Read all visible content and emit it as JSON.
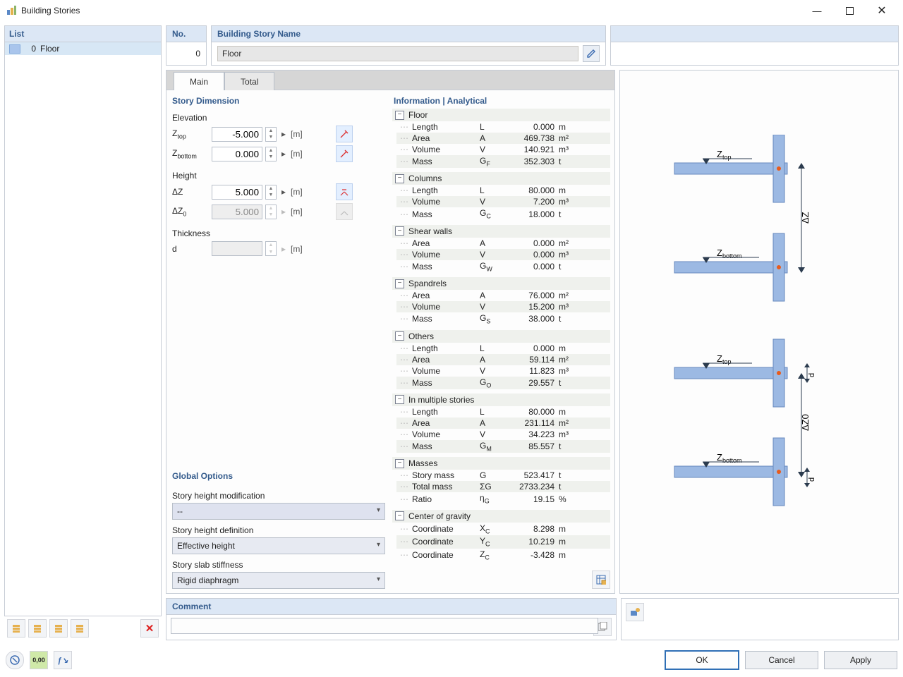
{
  "window": {
    "title": "Building Stories"
  },
  "left": {
    "header": "List",
    "items": [
      {
        "index": "0",
        "name": "Floor"
      }
    ]
  },
  "top": {
    "no_label": "No.",
    "no_value": "0",
    "name_label": "Building Story Name",
    "name_value": "Floor"
  },
  "tabs": {
    "main": "Main",
    "total": "Total"
  },
  "story_dim": {
    "header": "Story Dimension",
    "elev_label": "Elevation",
    "z_top": "Z",
    "z_top_sub": "top",
    "z_top_val": "-5.000",
    "unit": "[m]",
    "z_bot": "Z",
    "z_bot_sub": "bottom",
    "z_bot_val": "0.000",
    "height_label": "Height",
    "dz": "ΔZ",
    "dz_val": "5.000",
    "dz0": "ΔZ",
    "dz0_sub": "0",
    "dz0_val": "5.000",
    "thick_label": "Thickness",
    "d": "d",
    "d_val": ""
  },
  "globals": {
    "header": "Global Options",
    "mod_label": "Story height modification",
    "mod_val": "--",
    "def_label": "Story height definition",
    "def_val": "Effective height",
    "slab_label": "Story slab stiffness",
    "slab_val": "Rigid diaphragm"
  },
  "info": {
    "header": "Information | Analytical",
    "sections": [
      {
        "title": "Floor",
        "rows": [
          {
            "n": "Length",
            "s": "L",
            "v": "0.000",
            "u": "m"
          },
          {
            "n": "Area",
            "s": "A",
            "v": "469.738",
            "u": "m²"
          },
          {
            "n": "Volume",
            "s": "V",
            "v": "140.921",
            "u": "m³"
          },
          {
            "n": "Mass",
            "s": "G",
            "sub": "F",
            "v": "352.303",
            "u": "t"
          }
        ]
      },
      {
        "title": "Columns",
        "rows": [
          {
            "n": "Length",
            "s": "L",
            "v": "80.000",
            "u": "m"
          },
          {
            "n": "Volume",
            "s": "V",
            "v": "7.200",
            "u": "m³"
          },
          {
            "n": "Mass",
            "s": "G",
            "sub": "C",
            "v": "18.000",
            "u": "t"
          }
        ]
      },
      {
        "title": "Shear walls",
        "rows": [
          {
            "n": "Area",
            "s": "A",
            "v": "0.000",
            "u": "m²"
          },
          {
            "n": "Volume",
            "s": "V",
            "v": "0.000",
            "u": "m³"
          },
          {
            "n": "Mass",
            "s": "G",
            "sub": "W",
            "v": "0.000",
            "u": "t"
          }
        ]
      },
      {
        "title": "Spandrels",
        "rows": [
          {
            "n": "Area",
            "s": "A",
            "v": "76.000",
            "u": "m²"
          },
          {
            "n": "Volume",
            "s": "V",
            "v": "15.200",
            "u": "m³"
          },
          {
            "n": "Mass",
            "s": "G",
            "sub": "S",
            "v": "38.000",
            "u": "t"
          }
        ]
      },
      {
        "title": "Others",
        "rows": [
          {
            "n": "Length",
            "s": "L",
            "v": "0.000",
            "u": "m"
          },
          {
            "n": "Area",
            "s": "A",
            "v": "59.114",
            "u": "m²"
          },
          {
            "n": "Volume",
            "s": "V",
            "v": "11.823",
            "u": "m³"
          },
          {
            "n": "Mass",
            "s": "G",
            "sub": "O",
            "v": "29.557",
            "u": "t"
          }
        ]
      },
      {
        "title": "In multiple stories",
        "rows": [
          {
            "n": "Length",
            "s": "L",
            "v": "80.000",
            "u": "m"
          },
          {
            "n": "Area",
            "s": "A",
            "v": "231.114",
            "u": "m²"
          },
          {
            "n": "Volume",
            "s": "V",
            "v": "34.223",
            "u": "m³"
          },
          {
            "n": "Mass",
            "s": "G",
            "sub": "M",
            "v": "85.557",
            "u": "t"
          }
        ]
      },
      {
        "title": "Masses",
        "rows": [
          {
            "n": "Story mass",
            "s": "G",
            "v": "523.417",
            "u": "t"
          },
          {
            "n": "Total mass",
            "s": "ΣG",
            "v": "2733.234",
            "u": "t"
          },
          {
            "n": "Ratio",
            "s": "η",
            "sub": "G",
            "v": "19.15",
            "u": "%"
          }
        ]
      },
      {
        "title": "Center of gravity",
        "rows": [
          {
            "n": "Coordinate",
            "s": "X",
            "sub": "C",
            "v": "8.298",
            "u": "m"
          },
          {
            "n": "Coordinate",
            "s": "Y",
            "sub": "C",
            "v": "10.219",
            "u": "m"
          },
          {
            "n": "Coordinate",
            "s": "Z",
            "sub": "C",
            "v": "-3.428",
            "u": "m"
          }
        ]
      }
    ]
  },
  "comment": {
    "label": "Comment",
    "value": ""
  },
  "buttons": {
    "ok": "OK",
    "cancel": "Cancel",
    "apply": "Apply"
  },
  "diagram": {
    "ztop": "Z",
    "ztop_sub": "top",
    "zbot": "Z",
    "zbot_sub": "bottom",
    "dz": "ΔZ",
    "dz0": "ΔZ0",
    "d": "d"
  }
}
